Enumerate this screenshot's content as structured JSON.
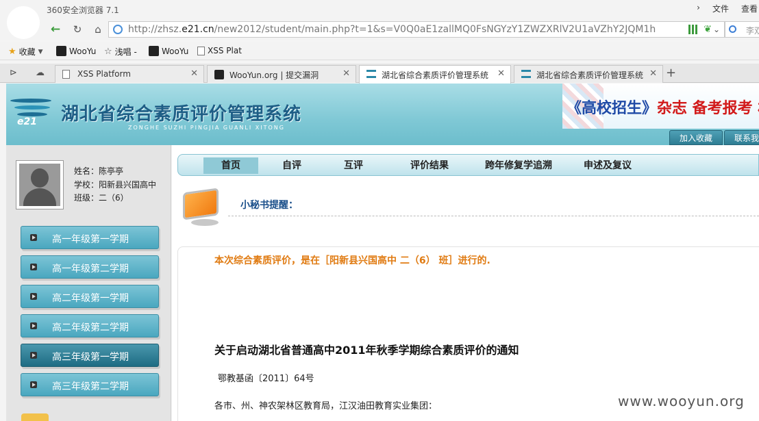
{
  "browser": {
    "app_title": "360安全浏览器 7.1",
    "title_actions": [
      "文件",
      "查看"
    ],
    "url_prefix": "http://zhsz.",
    "url_host": "e21.cn",
    "url_rest": "/new2012/student/main.php?t=1&s=V0Q0aE1zallMQ0FsNGYzY1ZWZXRlV2U1aVZhY2JQM1h",
    "search_text": "李双"
  },
  "bookmarks": [
    {
      "label": "收藏",
      "icon": "star-icon"
    },
    {
      "label": "WooYu",
      "icon": "wooyun-logo-icon"
    },
    {
      "label": "浅唱 -",
      "icon": "outline-star-icon"
    },
    {
      "label": "WooYu",
      "icon": "wooyun-logo-icon"
    },
    {
      "label": "XSS Plat",
      "icon": "document-icon"
    }
  ],
  "tabs": [
    {
      "label": "XSS Platform",
      "icon": "document-icon",
      "active": false
    },
    {
      "label": "WooYun.org | 提交漏洞",
      "icon": "wooyun-logo-icon",
      "active": false
    },
    {
      "label": "湖北省综合素质评价管理系统",
      "icon": "e21-logo-icon",
      "active": true
    },
    {
      "label": "湖北省综合素质评价管理系统",
      "icon": "e21-logo-icon",
      "active": false
    }
  ],
  "site": {
    "title": "湖北省综合素质评价管理系统",
    "subtitle": "ZONGHE SUZHI PINGJIA GUANLI XITONG",
    "logo_text": "e21",
    "banner_main": "《高校招生》",
    "banner_rest": "杂志  备考报考 权威",
    "header_buttons": [
      "加入收藏",
      "联系我"
    ]
  },
  "student": {
    "name_line": "姓名：陈亭亭",
    "school_line": "学校：阳新县兴国高中",
    "class_line": "班级：二（6）"
  },
  "terms": [
    {
      "label": "高一年级第一学期",
      "active": false
    },
    {
      "label": "高一年级第二学期",
      "active": false
    },
    {
      "label": "高二年级第一学期",
      "active": false
    },
    {
      "label": "高二年级第二学期",
      "active": false
    },
    {
      "label": "高三年级第一学期",
      "active": true
    },
    {
      "label": "高三年级第二学期",
      "active": false
    }
  ],
  "nav": [
    {
      "label": "首页",
      "active": true
    },
    {
      "label": "自评",
      "active": false
    },
    {
      "label": "互评",
      "active": false
    },
    {
      "label": "评价结果",
      "active": false
    },
    {
      "label": "跨年修复学追溯",
      "active": false
    },
    {
      "label": "申述及复议",
      "active": false
    }
  ],
  "notice": {
    "title": "小秘书提醒："
  },
  "content": {
    "eval_line": "本次综合素质评价，是在［阳新县兴国高中 二（6） 班］进行的.",
    "article_title": "关于启动湖北省普通高中2011年秋季学期综合素质评价的通知",
    "doc_no": "鄂教基函〔2011〕64号",
    "addressee": "各市、州、神农架林区教育局，江汉油田教育实业集团："
  },
  "watermark": "www.wooyun.org",
  "colors": {
    "header_teal": "#7fc8d5",
    "term_active": "#1e6c83",
    "eval_orange": "#e07b12",
    "notice_blue": "#1a4f8a"
  }
}
